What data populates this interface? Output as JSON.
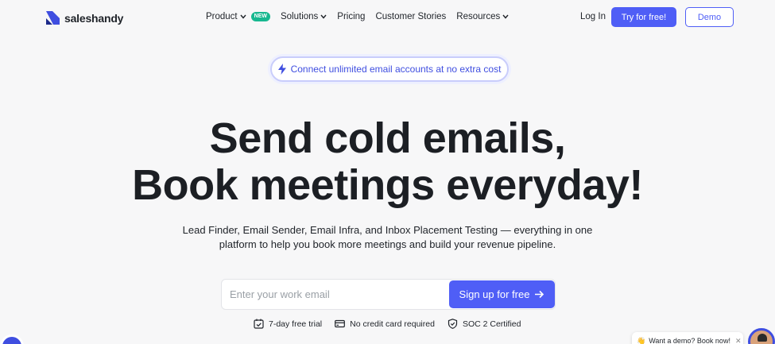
{
  "brand": {
    "name": "saleshandy",
    "color": "#4f5ef6"
  },
  "nav": {
    "items": [
      {
        "label": "Product",
        "has_chevron": true,
        "badge": "NEW"
      },
      {
        "label": "Solutions",
        "has_chevron": true
      },
      {
        "label": "Pricing",
        "has_chevron": false
      },
      {
        "label": "Customer Stories",
        "has_chevron": false
      },
      {
        "label": "Resources",
        "has_chevron": true
      }
    ],
    "login": "Log In",
    "try_free": "Try for free!",
    "demo": "Demo"
  },
  "announcement": {
    "text": "Connect unlimited email accounts at no extra cost",
    "icon": "bolt-icon"
  },
  "hero": {
    "title_line1": "Send cold emails,",
    "title_line2": "Book meetings everyday!",
    "subtitle_line1": "Lead Finder, Email Sender, Email Infra, and Inbox Placement Testing — everything in one",
    "subtitle_line2": "platform to help you book more meetings and build your revenue pipeline."
  },
  "signup": {
    "placeholder": "Enter your work email",
    "button": "Sign up for free",
    "button_icon": "arrow-right-icon"
  },
  "features": [
    {
      "icon": "calendar-check-icon",
      "label": "7-day free trial"
    },
    {
      "icon": "credit-card-icon",
      "label": "No credit card required"
    },
    {
      "icon": "shield-check-icon",
      "label": "SOC 2 Certified"
    }
  ],
  "chat": {
    "bubble_text": "Want a demo? Book now!",
    "bubble_emoji": "👋",
    "close": "✕"
  },
  "colors": {
    "accent": "#4f5ef6",
    "badge": "#17b890",
    "background": "#f7f7f8"
  }
}
